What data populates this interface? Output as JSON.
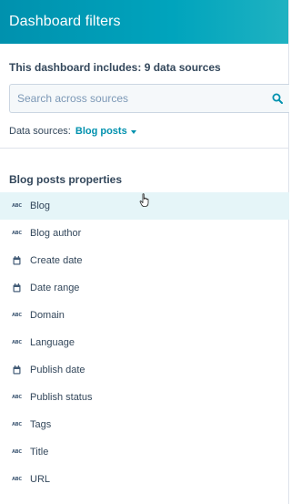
{
  "header": {
    "title": "Dashboard filters"
  },
  "summary": {
    "text": "This dashboard includes: 9 data sources"
  },
  "search": {
    "placeholder": "Search across sources",
    "value": ""
  },
  "sources": {
    "label": "Data sources:",
    "selected": "Blog posts"
  },
  "section": {
    "title": "Blog posts properties"
  },
  "properties": [
    {
      "label": "Blog",
      "icon": "text-property-icon",
      "type_text": "ABC"
    },
    {
      "label": "Blog author",
      "icon": "text-property-icon",
      "type_text": "ABC"
    },
    {
      "label": "Create date",
      "icon": "calendar-icon"
    },
    {
      "label": "Date range",
      "icon": "calendar-icon"
    },
    {
      "label": "Domain",
      "icon": "text-property-icon",
      "type_text": "ABC"
    },
    {
      "label": "Language",
      "icon": "text-property-icon",
      "type_text": "ABC"
    },
    {
      "label": "Publish date",
      "icon": "calendar-icon"
    },
    {
      "label": "Publish status",
      "icon": "text-property-icon",
      "type_text": "ABC"
    },
    {
      "label": "Tags",
      "icon": "text-property-icon",
      "type_text": "ABC"
    },
    {
      "label": "Title",
      "icon": "text-property-icon",
      "type_text": "ABC"
    },
    {
      "label": "URL",
      "icon": "text-property-icon",
      "type_text": "ABC"
    }
  ],
  "colors": {
    "header_start": "#0091ae",
    "header_end": "#1fb2c1",
    "link": "#0091ae",
    "text": "#33475b",
    "hover_row": "#e5f5f8"
  }
}
